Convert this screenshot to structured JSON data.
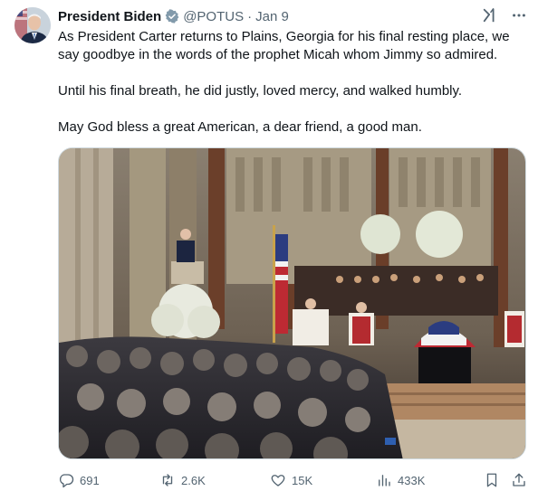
{
  "tweet": {
    "author_name": "President Biden",
    "handle": "@POTUS",
    "separator": "·",
    "date": "Jan 9",
    "paragraphs": [
      "As President Carter returns to Plains, Georgia for his final resting place, we say goodbye in the words of the prophet Micah whom Jimmy so admired.",
      "Until his final breath, he did justly, loved mercy, and walked humbly.",
      "May God bless a great American, a dear friend, a good man."
    ],
    "media": {
      "description_icon": "photo-cathedral-funeral"
    },
    "stats": {
      "replies": "691",
      "reposts": "2.6K",
      "likes": "15K",
      "views": "433K"
    }
  },
  "icons": {
    "verified": "verified-badge-icon",
    "grok": "grok-icon",
    "more": "more-icon",
    "reply": "reply-icon",
    "repost": "repost-icon",
    "like": "heart-icon",
    "views": "views-icon",
    "bookmark": "bookmark-icon",
    "share": "share-icon"
  },
  "colors": {
    "text": "#0f1419",
    "muted": "#536471",
    "badge": "#829aab",
    "border": "#cfd9de"
  }
}
